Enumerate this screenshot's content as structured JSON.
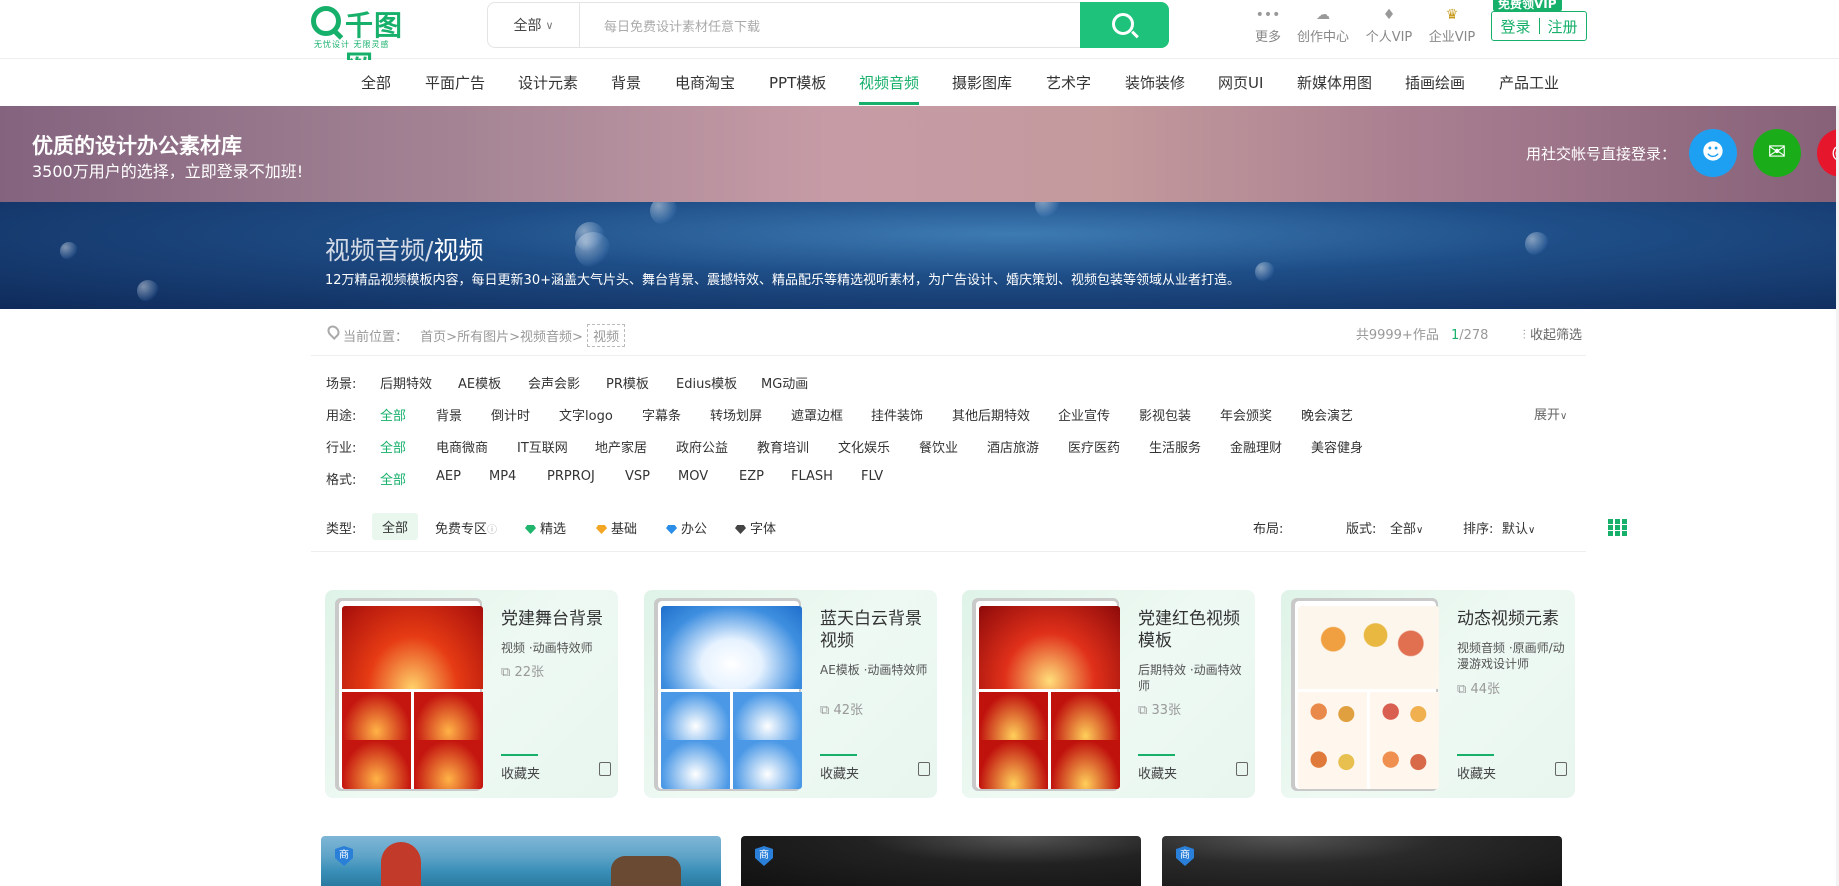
{
  "header": {
    "logo_name": "千图网",
    "logo_slogan": "无忧设计  无限灵感",
    "search_scope": "全部",
    "search_placeholder": "每日免费设计素材任意下载",
    "nav": [
      {
        "icon": "•••",
        "label": "更多"
      },
      {
        "icon": "☁",
        "label": "创作中心"
      },
      {
        "icon": "♦",
        "label": "个人VIP"
      },
      {
        "icon": "♛",
        "label": "企业VIP"
      }
    ],
    "vip_tag": "免费领VIP",
    "login_label": "登录",
    "register_label": "注册"
  },
  "categories": [
    "全部",
    "平面广告",
    "设计元素",
    "背景",
    "电商淘宝",
    "PPT模板",
    "视频音频",
    "摄影图库",
    "艺术字",
    "装饰装修",
    "网页UI",
    "新媒体用图",
    "插画绘画",
    "产品工业"
  ],
  "active_category": "视频音频",
  "login_banner": {
    "title": "优质的设计办公素材库",
    "subtitle": "3500万用户的选择，立即登录不加班!",
    "social_prompt": "用社交帐号直接登录："
  },
  "hero": {
    "title_prefix": "视频音频/",
    "title_current": "视频",
    "description": "12万精品视频模板内容，每日更新30+涵盖大气片头、舞台背景、震撼特效、精品配乐等精选视听素材，为广告设计、婚庆策划、视频包装等领域从业者打造。"
  },
  "breadcrumb": {
    "prefix": "当前位置：",
    "items": [
      "首页",
      "所有图片",
      "视频音频"
    ],
    "current": "视频",
    "total": "共9999+作品",
    "page_current": "1",
    "page_total": "/278",
    "collapse": "收起筛选"
  },
  "filters": {
    "scene": {
      "label": "场景:",
      "options": [
        "后期特效",
        "AE模板",
        "会声会影",
        "PR模板",
        "Edius模板",
        "MG动画"
      ]
    },
    "use": {
      "label": "用途:",
      "options": [
        "全部",
        "背景",
        "倒计时",
        "文字logo",
        "字幕条",
        "转场划屏",
        "遮罩边框",
        "挂件装饰",
        "其他后期特效",
        "企业宣传",
        "影视包装",
        "年会颁奖",
        "晚会演艺"
      ]
    },
    "industry": {
      "label": "行业:",
      "options": [
        "全部",
        "电商微商",
        "IT互联网",
        "地产家居",
        "政府公益",
        "教育培训",
        "文化娱乐",
        "餐饮业",
        "酒店旅游",
        "医疗医药",
        "生活服务",
        "金融理财",
        "美容健身"
      ]
    },
    "format": {
      "label": "格式:",
      "options": [
        "全部",
        "AEP",
        "MP4",
        "PRPROJ",
        "VSP",
        "MOV",
        "EZP",
        "FLASH",
        "FLV"
      ]
    },
    "expand": "展开"
  },
  "typebar": {
    "label": "类型:",
    "all": "全部",
    "free": "免费专区",
    "types": [
      {
        "name": "精选",
        "color": "#1fb56c"
      },
      {
        "name": "基础",
        "color": "#f3a623"
      },
      {
        "name": "办公",
        "color": "#2a8ee8"
      },
      {
        "name": "字体",
        "color": "#444444"
      }
    ],
    "layout_label": "布局:",
    "version_label": "版式:",
    "version_value": "全部",
    "sort_label": "排序:",
    "sort_value": "默认"
  },
  "cards": [
    {
      "title": "党建舞台背景",
      "meta": "视频 ·动画特效师",
      "count": "22张",
      "fav": "收藏夹",
      "theme": "red"
    },
    {
      "title": "蓝天白云背景视频",
      "meta": "AE模板 ·动画特效师",
      "count": "42张",
      "fav": "收藏夹",
      "theme": "sky"
    },
    {
      "title": "党建红色视频模板",
      "meta": "后期特效 ·动画特效师",
      "count": "33张",
      "fav": "收藏夹",
      "theme": "red2"
    },
    {
      "title": "动态视频元素",
      "meta": "视频音频 ·原画师/动漫游戏设计师",
      "count": "44张",
      "fav": "收藏夹",
      "theme": "tree"
    }
  ],
  "bottom_badge": "商"
}
